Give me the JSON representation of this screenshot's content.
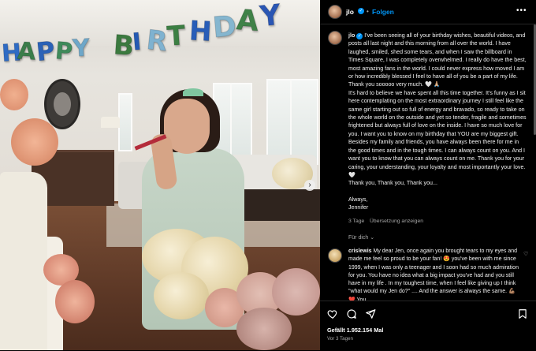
{
  "banner": {
    "letters": [
      {
        "ch": "H",
        "color": "#2e6bc4"
      },
      {
        "ch": "A",
        "color": "#3a7d4a"
      },
      {
        "ch": "P",
        "color": "#2b62b7"
      },
      {
        "ch": "P",
        "color": "#3f8a5a"
      },
      {
        "ch": "Y",
        "color": "#6ea7c9"
      },
      {
        "ch": "B",
        "color": "#3b7a3f"
      },
      {
        "ch": "I",
        "color": "#2459b3"
      },
      {
        "ch": "R",
        "color": "#7fb2d0"
      },
      {
        "ch": "T",
        "color": "#3c7f43"
      },
      {
        "ch": "H",
        "color": "#275db8"
      },
      {
        "ch": "D",
        "color": "#85b6cf"
      },
      {
        "ch": "A",
        "color": "#3f8248"
      },
      {
        "ch": "Y",
        "color": "#2a56b4"
      }
    ]
  },
  "header": {
    "username": "jlo",
    "separator": "•",
    "follow_label": "Folgen",
    "more_label": "•••"
  },
  "post": {
    "caption_p1": "I've been seeing all of your birthday wishes, beautiful videos, and posts all last night and this morning from all over the world. I have laughed, smiled, shed some tears, and when I saw the billboard in Times Square, I was completely overwhelmed. I really do have the best, most amazing fans in the world. I could never express how moved I am or how incredibly blessed I feel to have all of you be a part of my life. Thank you sooooo very much. 🤍 🙏🏼",
    "caption_p2": "It's hard to believe we have spent all this time together. It's funny as I sit here contemplating on the most extraordinary journey I still feel like the same girl starting out so full of energy and bravado, so ready to take on the whole world on the outside and yet so tender, fragile and sometimes frightened but always full of love on the inside. I have so much love for you. I want you to know on my birthday that YOU are my biggest gift. Besides my family and friends, you have always been there for me in the good times and in the tough times. I can always count on you. And I want you to know that you can always count on me. Thank you for your caring, your understanding, your loyalty and most importantly your love. 🤍",
    "caption_p3": "Thank you, Thank you, Thank you...",
    "signoff_1": "Always,",
    "signoff_2": "Jennifer",
    "age": "3 Tage",
    "translate": "Übersetzung anzeigen",
    "followed_by": "Für dich ⌄",
    "likes": "Gefällt 1.952.154 Mal",
    "posted": "Vor 3 Tagen"
  },
  "comment": {
    "user": "crislewis",
    "text": "My dear Jen, once again you brought tears to my eyes and made me feel so proud to be your fan! 😍 you've been with me since 1999, when I was only a teenager and I soon had so much admiration for you. You have no idea what a big impact you've had and you still have in my life . In my toughest time, when I feel like giving up I think \"what would my Jen do?\" .... And the answer is always the same. 💪🏽 ❤️ You"
  },
  "colors": {
    "accent": "#0095f6",
    "panel_bg": "#000000",
    "muted_text": "#a8a8a8"
  },
  "icons": {
    "like": "heart-icon",
    "comment": "comment-icon",
    "share": "send-icon",
    "save": "bookmark-icon",
    "next": "chevron-right-icon",
    "verified": "verified-icon"
  }
}
